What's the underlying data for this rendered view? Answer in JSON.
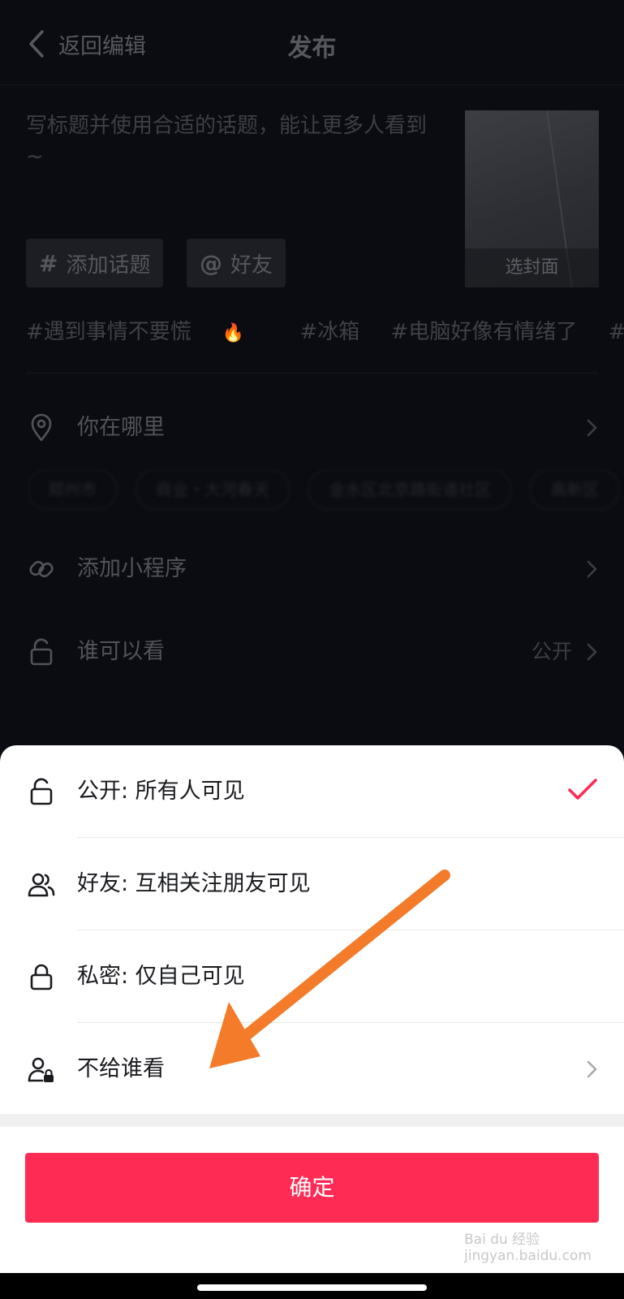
{
  "header": {
    "back_label": "返回编辑",
    "title": "发布"
  },
  "caption": {
    "placeholder": "写标题并使用合适的话题，能让更多人看到 ~",
    "cover_label": "选封面"
  },
  "chips": {
    "topic_symbol": "#",
    "topic_label": "添加话题",
    "mention_symbol": "@",
    "mention_label": "好友"
  },
  "trending": [
    "#遇到事情不要慌",
    "#冰箱",
    "#电脑好像有情绪了",
    "#小"
  ],
  "location": {
    "label": "你在哪里",
    "tags": [
      "郑州市",
      "商业・大河春天",
      "金水区北京路街道社区",
      "高新区"
    ]
  },
  "mini_program": {
    "label": "添加小程序"
  },
  "visibility": {
    "label": "谁可以看",
    "value": "公开"
  },
  "sheet": {
    "options": [
      {
        "label": "公开: 所有人可见",
        "selected": true
      },
      {
        "label": "好友: 互相关注朋友可见",
        "selected": false
      },
      {
        "label": "私密: 仅自己可见",
        "selected": false
      },
      {
        "label": "不给谁看",
        "selected": false
      }
    ],
    "confirm_label": "确定"
  },
  "watermark": "Bai du 经验  jingyan.baidu.com",
  "colors": {
    "accent": "#fe2c55",
    "annotation_arrow": "#f47b2a",
    "background_dark": "#0b0c11",
    "sheet_background": "#ffffff"
  },
  "icons": {
    "back": "chevron-left-icon",
    "location": "location-pin-icon",
    "mini_program": "link-icon",
    "visibility": "lock-open-icon",
    "public": "lock-open-icon",
    "friends": "friends-icon",
    "private": "lock-icon",
    "exclude": "user-lock-icon",
    "selected": "checkmark-icon",
    "more": "chevron-right-icon",
    "hot": "flame-icon"
  }
}
